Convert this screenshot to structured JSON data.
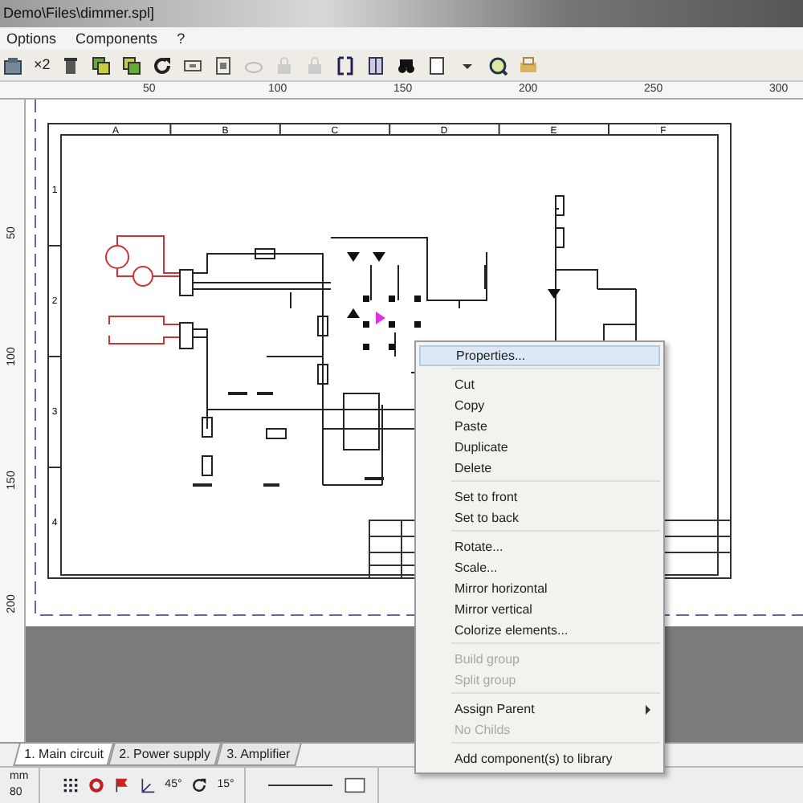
{
  "window": {
    "title": "Demo\\Files\\dimmer.spl]"
  },
  "menu_bar": [
    "Options",
    "Components",
    "?"
  ],
  "toolbar": {
    "multiplier": "×2"
  },
  "ruler": {
    "horizontal": [
      "50",
      "100",
      "150",
      "200",
      "250",
      "300"
    ],
    "vertical": [
      "50",
      "100",
      "150",
      "200"
    ]
  },
  "sheet": {
    "columns": [
      "A",
      "B",
      "C",
      "D",
      "E",
      "F"
    ],
    "rows": [
      "1",
      "2",
      "3",
      "4"
    ]
  },
  "context_menu": [
    {
      "kind": "item",
      "label": "Properties...",
      "selected": true,
      "disabled": false,
      "submenu": false
    },
    {
      "kind": "separator"
    },
    {
      "kind": "item",
      "label": "Cut",
      "selected": false,
      "disabled": false,
      "submenu": false
    },
    {
      "kind": "item",
      "label": "Copy",
      "selected": false,
      "disabled": false,
      "submenu": false
    },
    {
      "kind": "item",
      "label": "Paste",
      "selected": false,
      "disabled": false,
      "submenu": false
    },
    {
      "kind": "item",
      "label": "Duplicate",
      "selected": false,
      "disabled": false,
      "submenu": false
    },
    {
      "kind": "item",
      "label": "Delete",
      "selected": false,
      "disabled": false,
      "submenu": false
    },
    {
      "kind": "separator"
    },
    {
      "kind": "item",
      "label": "Set to front",
      "selected": false,
      "disabled": false,
      "submenu": false
    },
    {
      "kind": "item",
      "label": "Set to back",
      "selected": false,
      "disabled": false,
      "submenu": false
    },
    {
      "kind": "separator"
    },
    {
      "kind": "item",
      "label": "Rotate...",
      "selected": false,
      "disabled": false,
      "submenu": false
    },
    {
      "kind": "item",
      "label": "Scale...",
      "selected": false,
      "disabled": false,
      "submenu": false
    },
    {
      "kind": "item",
      "label": "Mirror horizontal",
      "selected": false,
      "disabled": false,
      "submenu": false
    },
    {
      "kind": "item",
      "label": "Mirror vertical",
      "selected": false,
      "disabled": false,
      "submenu": false
    },
    {
      "kind": "item",
      "label": "Colorize elements...",
      "selected": false,
      "disabled": false,
      "submenu": false
    },
    {
      "kind": "separator"
    },
    {
      "kind": "item",
      "label": "Build group",
      "selected": false,
      "disabled": true,
      "submenu": false
    },
    {
      "kind": "item",
      "label": "Split group",
      "selected": false,
      "disabled": true,
      "submenu": false
    },
    {
      "kind": "separator"
    },
    {
      "kind": "item",
      "label": "Assign Parent",
      "selected": false,
      "disabled": false,
      "submenu": true
    },
    {
      "kind": "item",
      "label": "No Childs",
      "selected": false,
      "disabled": true,
      "submenu": false
    },
    {
      "kind": "separator"
    },
    {
      "kind": "item",
      "label": "Add component(s) to library",
      "selected": false,
      "disabled": false,
      "submenu": false
    }
  ],
  "tabs": [
    {
      "label": "1. Main circuit",
      "selected": true
    },
    {
      "label": "2. Power supply",
      "selected": false
    },
    {
      "label": "3. Amplifier",
      "selected": false
    }
  ],
  "status_bar": {
    "units": "mm",
    "value": "80",
    "angle": "45°",
    "rotation": "15°"
  }
}
